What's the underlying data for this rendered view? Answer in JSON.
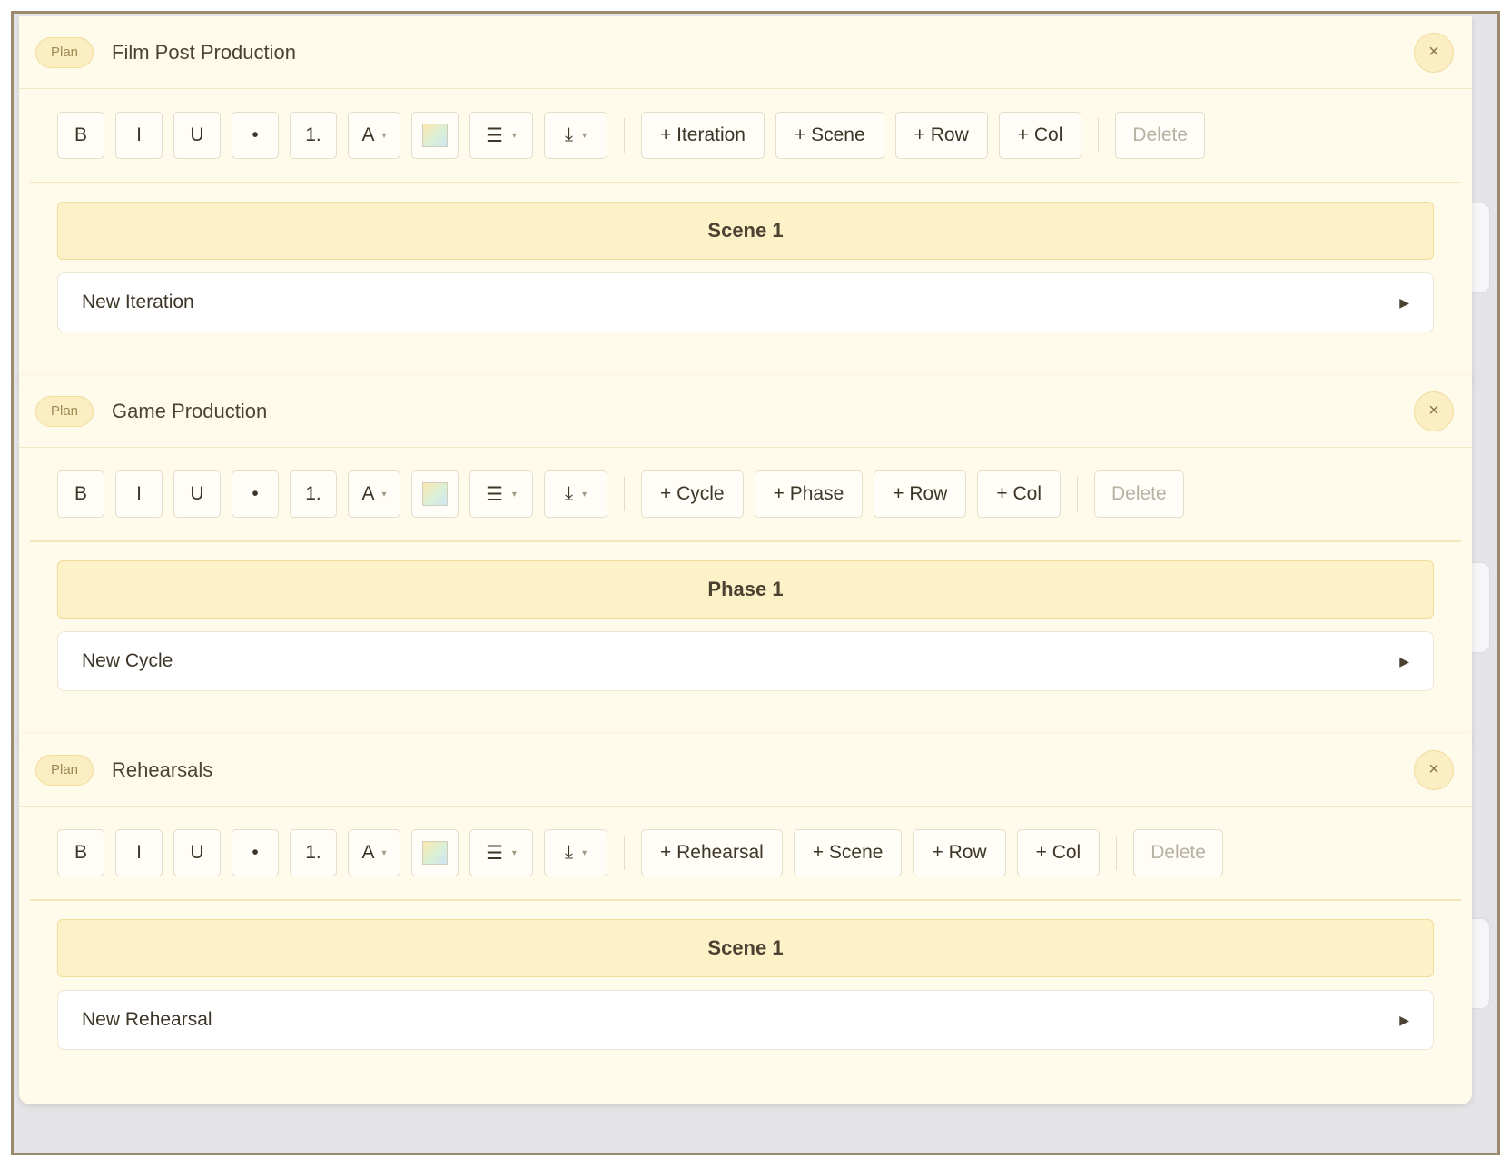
{
  "plans": [
    {
      "badge": "Plan",
      "title": "Film Post Production",
      "close_label": "×",
      "format": {
        "bold": "B",
        "italic": "I",
        "underline": "U",
        "bullet": "•",
        "numbered": "1.",
        "font_color": "A",
        "align_icon": "☰",
        "insert_icon": "⤓"
      },
      "actions": [
        "+ Iteration",
        "+ Scene",
        "+ Row",
        "+ Col"
      ],
      "delete_label": "Delete",
      "group": "Scene 1",
      "item": "New Iteration",
      "item_arrow": "▶"
    },
    {
      "badge": "Plan",
      "title": "Game Production",
      "close_label": "×",
      "format": {
        "bold": "B",
        "italic": "I",
        "underline": "U",
        "bullet": "•",
        "numbered": "1.",
        "font_color": "A",
        "align_icon": "☰",
        "insert_icon": "⤓"
      },
      "actions": [
        "+ Cycle",
        "+ Phase",
        "+ Row",
        "+ Col"
      ],
      "delete_label": "Delete",
      "group": "Phase 1",
      "item": "New Cycle",
      "item_arrow": "▶"
    },
    {
      "badge": "Plan",
      "title": "Rehearsals",
      "close_label": "×",
      "format": {
        "bold": "B",
        "italic": "I",
        "underline": "U",
        "bullet": "•",
        "numbered": "1.",
        "font_color": "A",
        "align_icon": "☰",
        "insert_icon": "⤓"
      },
      "actions": [
        "+ Rehearsal",
        "+ Scene",
        "+ Row",
        "+ Col"
      ],
      "delete_label": "Delete",
      "group": "Scene 1",
      "item": "New Rehearsal",
      "item_arrow": "▶"
    }
  ],
  "colors": {
    "panel_bg": "#fffbeb",
    "accent": "#fbeec3",
    "group_bg": "#fdf1c7",
    "frame_border": "#9c8a6e"
  }
}
